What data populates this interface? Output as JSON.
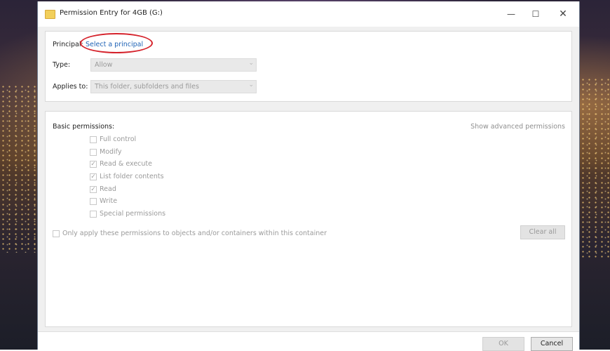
{
  "window": {
    "title": "Permission Entry for 4GB (G:)",
    "controls": {
      "minimize": "—",
      "maximize": "☐",
      "close": "✕"
    }
  },
  "principal_section": {
    "principal_label": "Principal:",
    "principal_link": "Select a principal",
    "type_label": "Type:",
    "type_value": "Allow",
    "applies_label": "Applies to:",
    "applies_value": "This folder, subfolders and files"
  },
  "permissions_section": {
    "heading": "Basic permissions:",
    "advanced_link": "Show advanced permissions",
    "items": [
      {
        "label": "Full control",
        "checked": false
      },
      {
        "label": "Modify",
        "checked": false
      },
      {
        "label": "Read & execute",
        "checked": true
      },
      {
        "label": "List folder contents",
        "checked": true
      },
      {
        "label": "Read",
        "checked": true
      },
      {
        "label": "Write",
        "checked": false
      },
      {
        "label": "Special permissions",
        "checked": false
      }
    ],
    "only_apply_label": "Only apply these permissions to objects and/or containers within this container",
    "clear_all": "Clear all"
  },
  "footer": {
    "ok": "OK",
    "cancel": "Cancel"
  },
  "icons": {
    "folder": "folder-icon",
    "dropdown": "chevron-down-icon",
    "check": "checkmark-icon"
  },
  "colors": {
    "link": "#1e62b5",
    "highlight_oval": "#d5222b",
    "folder": "#f2cf5b"
  }
}
